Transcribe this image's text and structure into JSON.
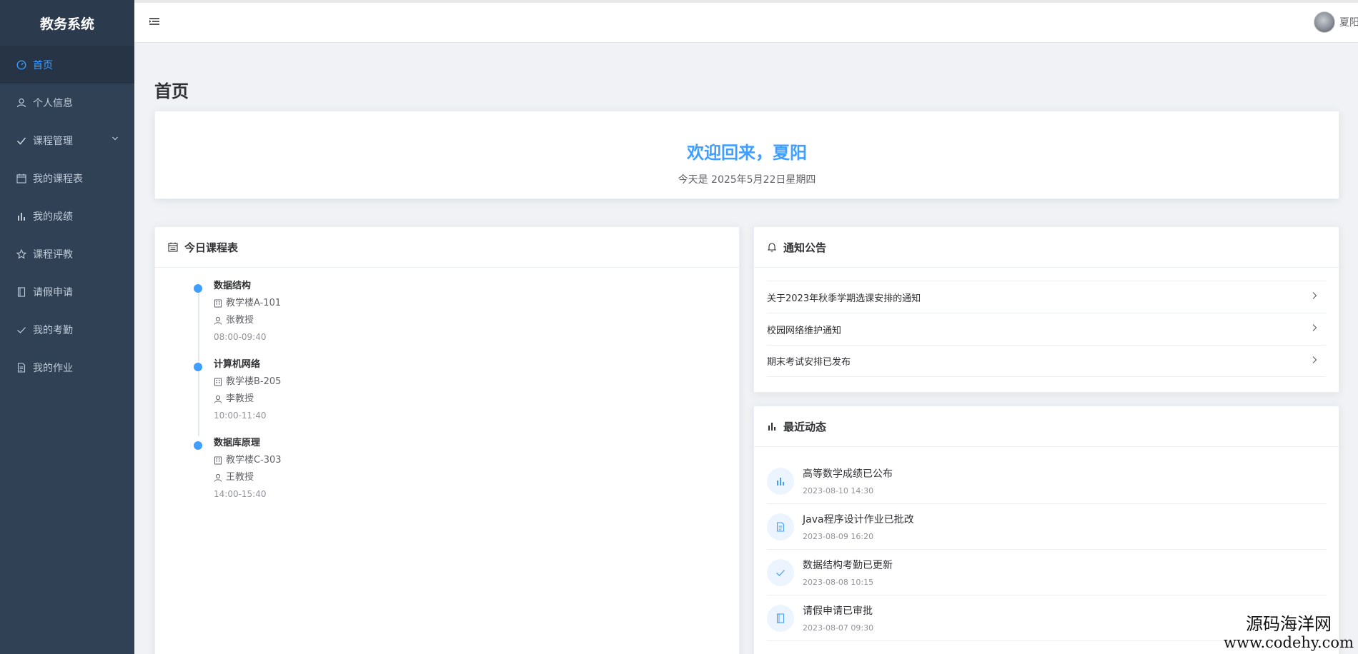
{
  "app": {
    "title": "教务系统"
  },
  "sidebar": {
    "items": [
      {
        "label": "首页",
        "icon": "dashboard-icon",
        "active": true
      },
      {
        "label": "个人信息",
        "icon": "user-icon"
      },
      {
        "label": "课程管理",
        "icon": "check-icon",
        "expandable": true
      },
      {
        "label": "我的课程表",
        "icon": "calendar-icon"
      },
      {
        "label": "我的成绩",
        "icon": "bar-chart-icon"
      },
      {
        "label": "课程评教",
        "icon": "star-icon"
      },
      {
        "label": "请假申请",
        "icon": "document-icon"
      },
      {
        "label": "我的考勤",
        "icon": "checkmark-icon"
      },
      {
        "label": "我的作业",
        "icon": "file-text-icon"
      }
    ]
  },
  "header": {
    "username": "夏阳"
  },
  "page": {
    "title": "首页"
  },
  "welcome": {
    "title": "欢迎回来，夏阳",
    "date": "今天是 2025年5月22日星期四"
  },
  "schedule": {
    "title": "今日课程表",
    "items": [
      {
        "course": "数据结构",
        "room": "教学楼A-101",
        "teacher": "张教授",
        "time": "08:00-09:40"
      },
      {
        "course": "计算机网络",
        "room": "教学楼B-205",
        "teacher": "李教授",
        "time": "10:00-11:40"
      },
      {
        "course": "数据库原理",
        "room": "教学楼C-303",
        "teacher": "王教授",
        "time": "14:00-15:40"
      }
    ]
  },
  "notices": {
    "title": "通知公告",
    "items": [
      {
        "text": "关于2023年秋季学期选课安排的通知"
      },
      {
        "text": "校园网络维护通知"
      },
      {
        "text": "期末考试安排已发布"
      }
    ]
  },
  "activity": {
    "title": "最近动态",
    "items": [
      {
        "title": "高等数学成绩已公布",
        "time": "2023-08-10 14:30",
        "icon": "bar-chart-icon"
      },
      {
        "title": "Java程序设计作业已批改",
        "time": "2023-08-09 16:20",
        "icon": "document-icon"
      },
      {
        "title": "数据结构考勤已更新",
        "time": "2023-08-08 10:15",
        "icon": "checkmark-icon"
      },
      {
        "title": "请假申请已审批",
        "time": "2023-08-07 09:30",
        "icon": "book-icon"
      }
    ]
  },
  "watermark": {
    "cn": "源码海洋网",
    "url": "www.codehy.com"
  },
  "colors": {
    "sidebar_bg": "#304156",
    "accent": "#409eff"
  }
}
